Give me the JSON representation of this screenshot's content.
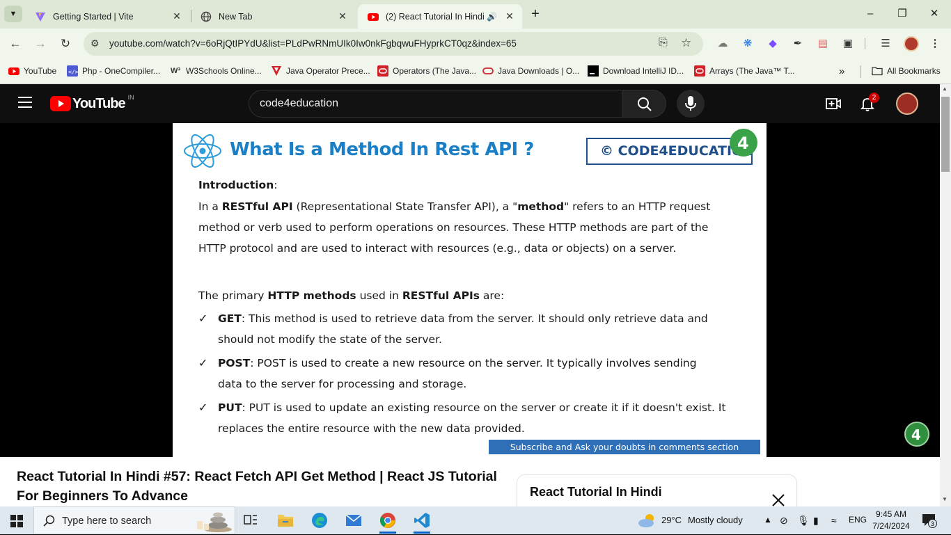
{
  "browser": {
    "tabs": [
      {
        "title": "Getting Started | Vite",
        "icon": "vite-icon"
      },
      {
        "title": "New Tab",
        "icon": "chrome-icon"
      },
      {
        "title": "(2) React Tutorial In Hindi #",
        "icon": "youtube-icon",
        "audio": true
      }
    ],
    "url": "youtube.com/watch?v=6oRjQtIPYdU&list=PLdPwRNmUIk0Iw0nkFgbqwuFHyprkCT0qz&index=65",
    "bookmarks": [
      {
        "label": "YouTube",
        "icon": "youtube-icon"
      },
      {
        "label": "Php - OneCompiler...",
        "icon": "onecompiler-icon"
      },
      {
        "label": "W3Schools Online...",
        "icon": "w3schools-icon"
      },
      {
        "label": "Java Operator Prece...",
        "icon": "red-v-icon"
      },
      {
        "label": "Operators (The Java...",
        "icon": "oracle-icon"
      },
      {
        "label": "Java Downloads | O...",
        "icon": "oracle-outline-icon"
      },
      {
        "label": "Download IntelliJ ID...",
        "icon": "jetbrains-icon"
      },
      {
        "label": "Arrays (The Java™ T...",
        "icon": "oracle-icon"
      }
    ],
    "all_bookmarks": "All Bookmarks"
  },
  "youtube": {
    "logo_text": "YouTube",
    "country": "IN",
    "search_value": "code4education",
    "notification_count": "2"
  },
  "slide": {
    "title": "What Is a Method In Rest API ?",
    "brand": "© CODE4EDUCATION",
    "intro_label": "Introduction",
    "intro_colon": ":",
    "p1_a": "In a ",
    "p1_b": "RESTful API",
    "p1_c": " (Representational State Transfer API), a \"",
    "p1_d": "method",
    "p1_e": "\" refers to an HTTP request",
    "p2": "method or verb used to perform operations on resources. These HTTP methods are part of the",
    "p3": "HTTP protocol and are used to interact with resources (e.g., data or objects) on a server.",
    "primary_a": "The primary ",
    "primary_b": "HTTP methods",
    "primary_c": " used in ",
    "primary_d": "RESTful APIs",
    "primary_e": " are:",
    "check": "✓",
    "get_label": "GET",
    "get_l1": ": This method is used to retrieve data from the server. It should only retrieve data and",
    "get_l2": "should not modify the state of the server.",
    "post_label": "POST",
    "post_l1": ": POST is used to create a new resource on the server. It typically involves sending",
    "post_l2": "data to the server for processing and storage.",
    "put_label": "PUT",
    "put_l1": ": PUT is used to update an existing resource on the server or create it if it doesn't exist. It",
    "put_l2": "replaces the entire resource with the new data provided.",
    "banner": "Subscribe and Ask your doubts in comments section"
  },
  "video": {
    "title": "React Tutorial In Hindi #57: React Fetch API Get Method | React JS Tutorial For Beginners To Advance"
  },
  "playlist": {
    "title": "React Tutorial In Hindi"
  },
  "taskbar": {
    "search_placeholder": "Type here to search",
    "weather_temp": "29°C",
    "weather_desc": "Mostly cloudy",
    "language": "ENG",
    "time": "9:45 AM",
    "date": "7/24/2024",
    "notification_count": "3"
  }
}
